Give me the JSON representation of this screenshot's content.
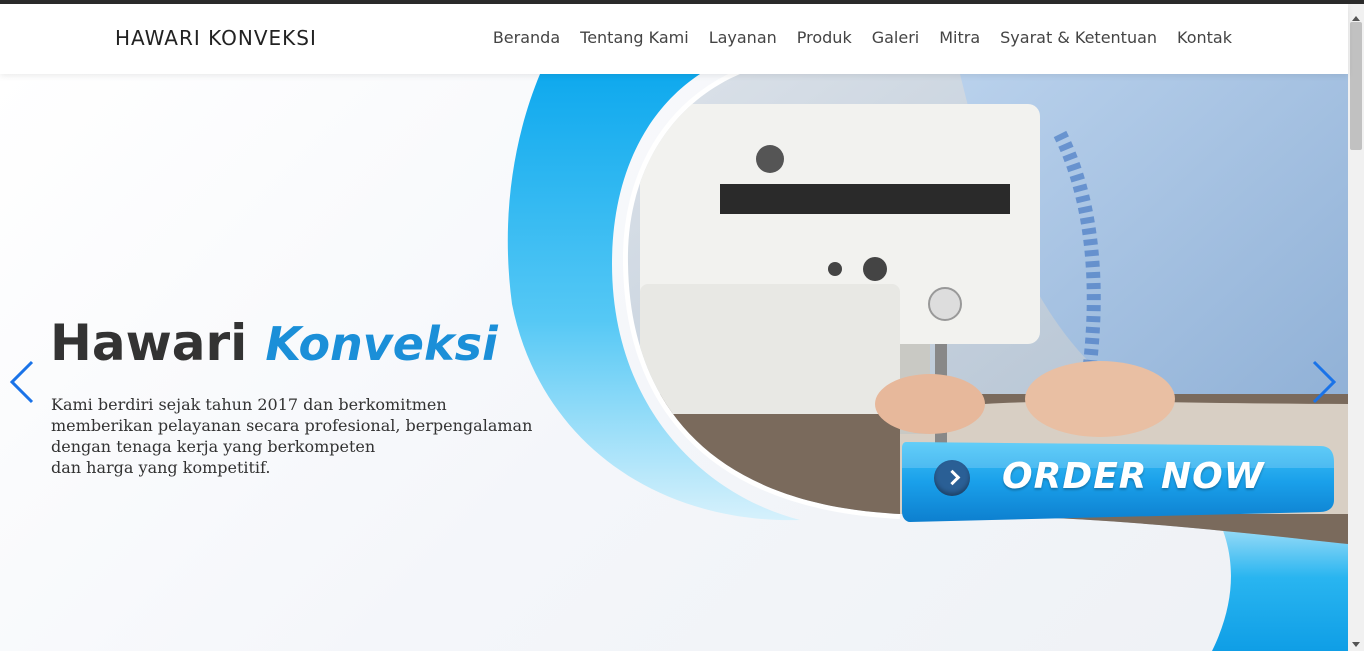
{
  "nav": {
    "brand": "HAWARI KONVEKSI",
    "items": [
      "Beranda",
      "Tentang Kami",
      "Layanan",
      "Produk",
      "Galeri",
      "Mitra",
      "Syarat & Ketentuan",
      "Kontak"
    ]
  },
  "hero": {
    "title_part1": "Hawari",
    "title_part2": "Konveksi",
    "description_lines": [
      "Kami berdiri sejak tahun 2017 dan berkomitmen",
      "memberikan pelayanan secara profesional, berpengalaman",
      "dengan  tenaga kerja yang berkompeten",
      "dan harga yang kompetitif."
    ],
    "cta_label": "ORDER NOW",
    "photo_subject": "sewing-machine-photo"
  },
  "icons": {
    "prev": "chevron-left-icon",
    "next": "chevron-right-icon",
    "cta": "arrow-circle-icon"
  },
  "colors": {
    "accent": "#1b8fd8",
    "cta_blue": "#1aa0ea",
    "text_dark": "#333333"
  }
}
